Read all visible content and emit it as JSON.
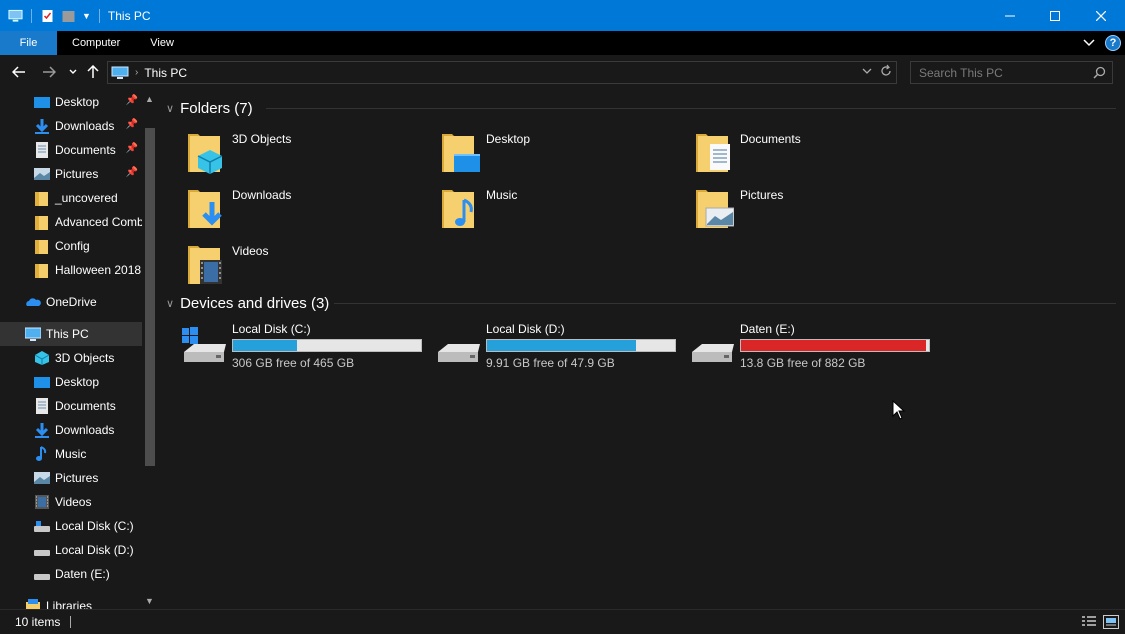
{
  "window": {
    "title": "This PC",
    "colors": {
      "titlebar": "#0078d7",
      "accent": "#1979ca",
      "bar_blue": "#26a0da",
      "bar_red": "#da2626"
    }
  },
  "ribbon": {
    "tabs": [
      "File",
      "Computer",
      "View"
    ]
  },
  "address": {
    "crumb": "This PC",
    "search_placeholder": "Search This PC"
  },
  "sidebar": {
    "items": [
      {
        "label": "Desktop",
        "icon": "desktop-icon",
        "pinned": true
      },
      {
        "label": "Downloads",
        "icon": "downloads-icon",
        "pinned": true
      },
      {
        "label": "Documents",
        "icon": "documents-icon",
        "pinned": true
      },
      {
        "label": "Pictures",
        "icon": "pictures-icon",
        "pinned": true
      },
      {
        "label": "_uncovered",
        "icon": "folder-icon",
        "pinned": false
      },
      {
        "label": "Advanced Comb",
        "icon": "folder-icon",
        "pinned": false
      },
      {
        "label": "Config",
        "icon": "folder-icon",
        "pinned": false
      },
      {
        "label": "Halloween 2018",
        "icon": "folder-icon",
        "pinned": false
      },
      {
        "label": "OneDrive",
        "icon": "onedrive-icon",
        "pinned": false
      },
      {
        "label": "This PC",
        "icon": "this-pc-icon",
        "pinned": false,
        "selected": true
      },
      {
        "label": "3D Objects",
        "icon": "3d-objects-icon",
        "pinned": false
      },
      {
        "label": "Desktop",
        "icon": "desktop-icon",
        "pinned": false
      },
      {
        "label": "Documents",
        "icon": "documents-icon",
        "pinned": false
      },
      {
        "label": "Downloads",
        "icon": "downloads-icon",
        "pinned": false
      },
      {
        "label": "Music",
        "icon": "music-icon",
        "pinned": false
      },
      {
        "label": "Pictures",
        "icon": "pictures-icon",
        "pinned": false
      },
      {
        "label": "Videos",
        "icon": "videos-icon",
        "pinned": false
      },
      {
        "label": "Local Disk (C:)",
        "icon": "drive-icon",
        "pinned": false
      },
      {
        "label": "Local Disk (D:)",
        "icon": "drive-icon",
        "pinned": false
      },
      {
        "label": "Daten (E:)",
        "icon": "drive-icon",
        "pinned": false
      },
      {
        "label": "Libraries",
        "icon": "libraries-icon",
        "pinned": false
      }
    ]
  },
  "folders": {
    "header": "Folders (7)",
    "items": [
      {
        "label": "3D Objects",
        "icon": "3d-objects-icon"
      },
      {
        "label": "Desktop",
        "icon": "desktop-icon"
      },
      {
        "label": "Documents",
        "icon": "documents-icon"
      },
      {
        "label": "Downloads",
        "icon": "downloads-icon"
      },
      {
        "label": "Music",
        "icon": "music-icon"
      },
      {
        "label": "Pictures",
        "icon": "pictures-icon"
      },
      {
        "label": "Videos",
        "icon": "videos-icon"
      }
    ]
  },
  "drives": {
    "header": "Devices and drives (3)",
    "items": [
      {
        "label": "Local Disk (C:)",
        "free": "306 GB free of 465 GB",
        "used_fraction": 0.34,
        "critical": false,
        "windows": true
      },
      {
        "label": "Local Disk (D:)",
        "free": "9.91 GB free of 47.9 GB",
        "used_fraction": 0.79,
        "critical": false,
        "windows": false
      },
      {
        "label": "Daten (E:)",
        "free": "13.8 GB free of 882 GB",
        "used_fraction": 0.984,
        "critical": true,
        "windows": false
      }
    ]
  },
  "status": {
    "count": "10 items"
  }
}
